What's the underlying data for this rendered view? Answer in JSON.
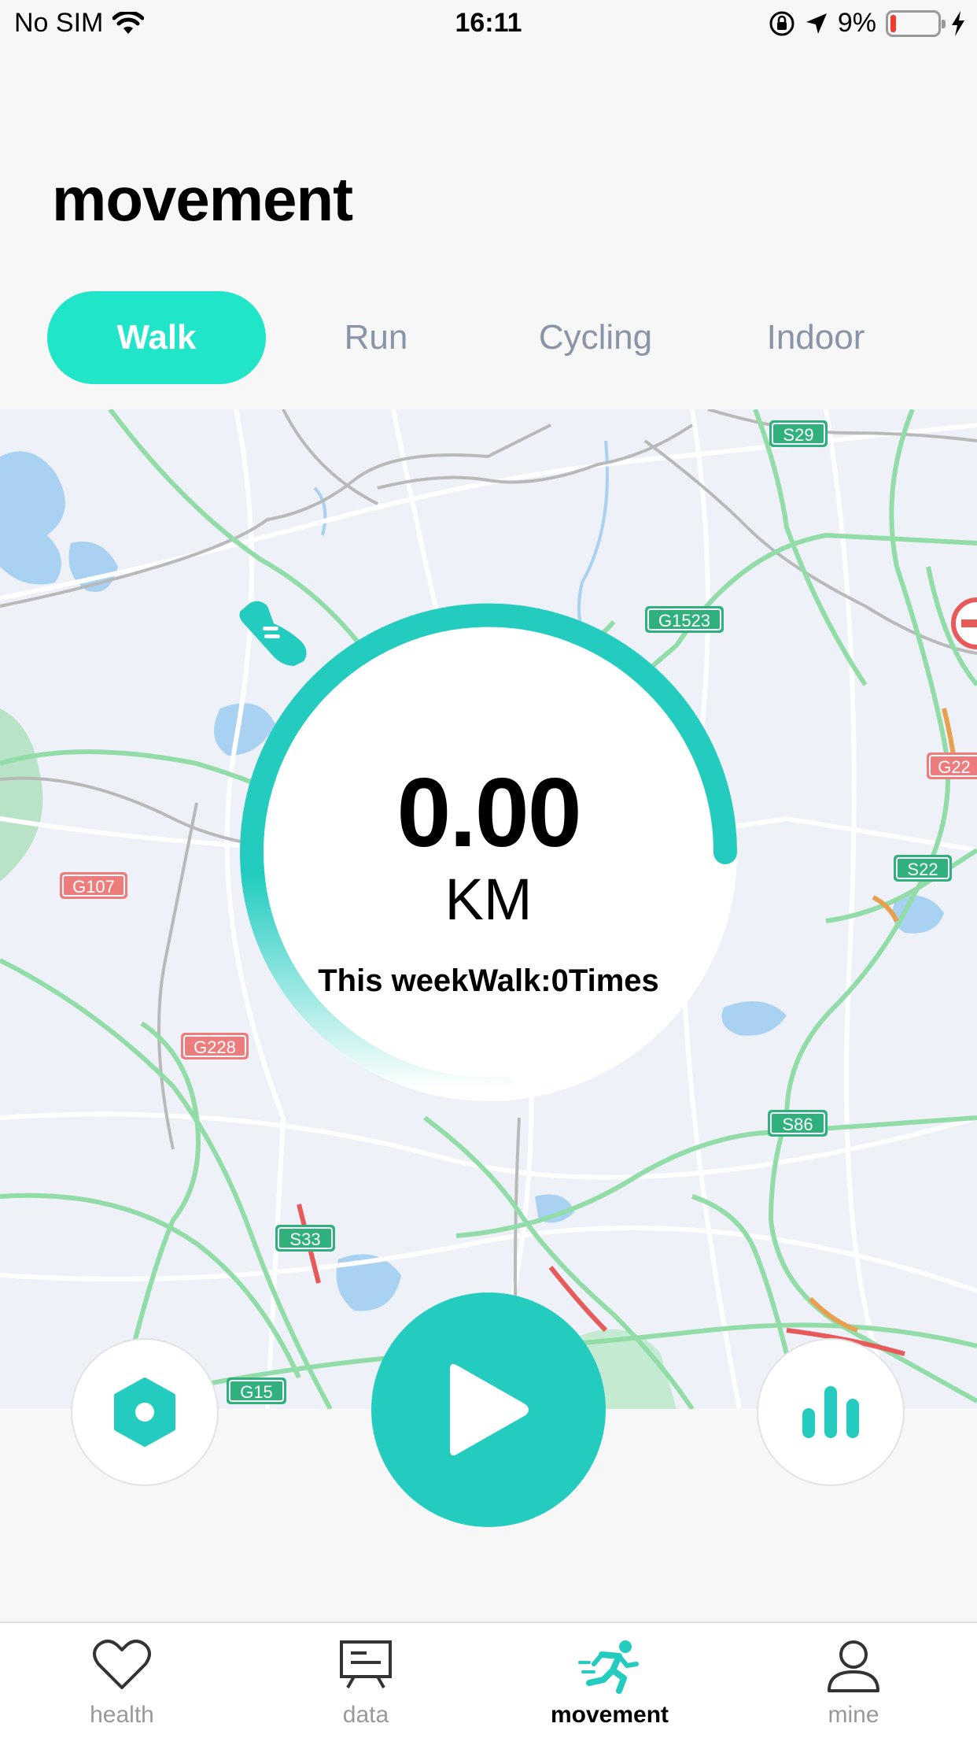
{
  "status_bar": {
    "carrier": "No SIM",
    "time": "16:11",
    "battery_percent": "9%",
    "battery_level": 0.09,
    "battery_color": "#f23b2f"
  },
  "page": {
    "title": "movement"
  },
  "tabs": [
    {
      "label": "Walk",
      "active": true
    },
    {
      "label": "Run",
      "active": false
    },
    {
      "label": "Cycling",
      "active": false
    },
    {
      "label": "Indoor",
      "active": false
    }
  ],
  "map": {
    "road_labels": [
      "S29",
      "G1523",
      "G22",
      "S22",
      "G107",
      "G228",
      "S86",
      "S33",
      "G15"
    ]
  },
  "summary": {
    "distance": "0.00",
    "unit": "KM",
    "week_text": "This weekWalk:0Times",
    "icon": "shoe-icon"
  },
  "controls": {
    "settings_icon": "hexagon-settings-icon",
    "play_icon": "play-icon",
    "stats_icon": "bar-chart-icon"
  },
  "colors": {
    "accent": "#21e5c8",
    "primary": "#24ccc0",
    "tab_inactive": "#8a94a8"
  },
  "bottom_nav": [
    {
      "label": "health",
      "icon": "heart-icon",
      "active": false
    },
    {
      "label": "data",
      "icon": "presentation-board-icon",
      "active": false
    },
    {
      "label": "movement",
      "icon": "running-person-icon",
      "active": true
    },
    {
      "label": "mine",
      "icon": "person-icon",
      "active": false
    }
  ]
}
